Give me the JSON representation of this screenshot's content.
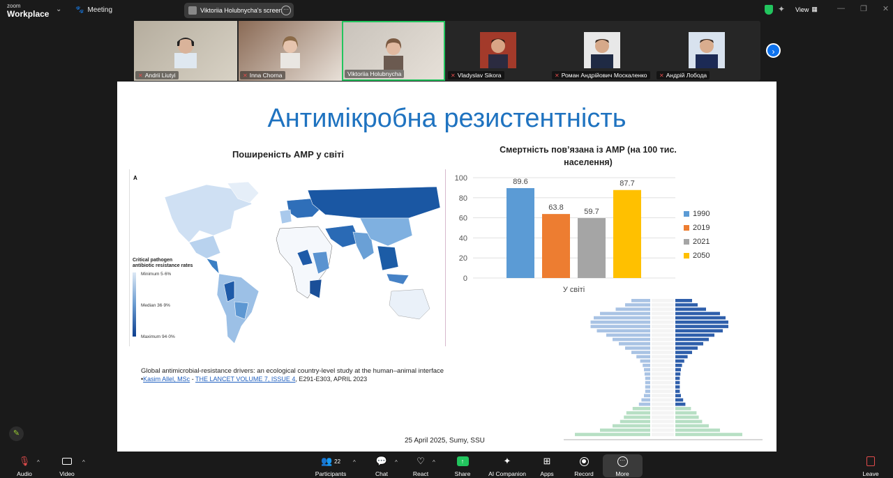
{
  "app": {
    "logo_line1": "zoom",
    "logo_line2": "Workplace",
    "meeting_label": "Meeting",
    "screen_share_label": "Viktoriia Holubnycha's screen",
    "view_label": "View"
  },
  "participants": [
    {
      "name": "Andrii Liutyi",
      "muted": true
    },
    {
      "name": "Inna Chorna",
      "muted": true
    },
    {
      "name": "Viktoriia Holubnycha",
      "muted": false,
      "active": true
    },
    {
      "name": "Vladyslav Sikora",
      "muted": true
    },
    {
      "name": "Роман Андрійович Москаленко",
      "muted": true
    },
    {
      "name": "Андрій Лобода",
      "muted": true
    }
  ],
  "slide": {
    "title": "Антимікробна резистентність",
    "map_title": "Поширеність АМР у світі",
    "bar_title_line1": "Смертність пов’язана із АМР (на 100 тис.",
    "bar_title_line2": "населення)",
    "map_panel_letter": "A",
    "legend_title_line1": "Critical pathogen",
    "legend_title_line2": "antibiotic resistance rates",
    "legend_min": "Minimum 5·6%",
    "legend_median": "Median 36·9%",
    "legend_max": "Maximum 94·0%",
    "reference_line1": "Global antimicrobial-resistance drivers: an ecological country-level study at the human–animal interface",
    "reference_author": "Kasim Allel, MSc",
    "reference_journal": "THE LANCET VOLUME 7, ISSUE 4",
    "reference_rest": ", E291-E303, APRIL 2023",
    "footer": "25 April 2025,  Sumy, SSU"
  },
  "chart_data": [
    {
      "type": "bar",
      "title": "Смертність пов’язана із АМР (на 100 тис. населення)",
      "categories": [
        "У світі"
      ],
      "series": [
        {
          "name": "1990",
          "values": [
            89.6
          ],
          "color": "#5b9bd5"
        },
        {
          "name": "2019",
          "values": [
            63.8
          ],
          "color": "#ed7d31"
        },
        {
          "name": "2021",
          "values": [
            59.7
          ],
          "color": "#a5a5a5"
        },
        {
          "name": "2050",
          "values": [
            87.7
          ],
          "color": "#ffc000"
        }
      ],
      "ylim": [
        0,
        100
      ],
      "yticks": [
        0,
        20,
        40,
        60,
        80,
        100
      ],
      "legend": "right",
      "grid": true
    }
  ],
  "controls": {
    "audio": "Audio",
    "video": "Video",
    "participants": "Participants",
    "participants_count": "22",
    "chat": "Chat",
    "react": "React",
    "share": "Share",
    "ai": "AI Companion",
    "apps": "Apps",
    "record": "Record",
    "more": "More",
    "leave": "Leave"
  },
  "colors": {
    "accent": "#0e72ed",
    "share_green": "#22c55e",
    "title_blue": "#1f73c0"
  }
}
